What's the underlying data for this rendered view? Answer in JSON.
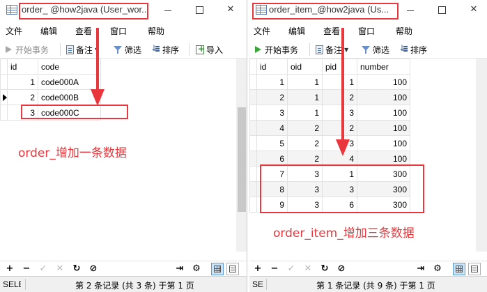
{
  "colors": {
    "annotation": "#e8383d",
    "grid_border": "#e2e2e2",
    "statusbar": "#f0f0f0"
  },
  "menu": [
    "文件",
    "编辑",
    "查看",
    "窗口",
    "帮助"
  ],
  "left": {
    "title": "order_ @how2java (User_wor...",
    "toolbar": {
      "begin_tx": "开始事务",
      "memo": "备注",
      "filter": "筛选",
      "sort": "排序",
      "import": "导入"
    },
    "columns": [
      "id",
      "code"
    ],
    "rows": [
      [
        "1",
        "code000A"
      ],
      [
        "2",
        "code000B"
      ],
      [
        "3",
        "code000C"
      ]
    ],
    "status_sql": "SELE",
    "status_record": "第 2 条记录 (共 3 条) 于第 1 页",
    "annotation": "order_增加一条数据"
  },
  "right": {
    "title": "order_item_@how2java (Us...",
    "toolbar": {
      "begin_tx": "开始事务",
      "memo": "备注",
      "filter": "筛选",
      "sort": "排序"
    },
    "columns": [
      "id",
      "oid",
      "pid",
      "number"
    ],
    "rows": [
      [
        "1",
        "1",
        "1",
        "100"
      ],
      [
        "2",
        "1",
        "2",
        "100"
      ],
      [
        "3",
        "1",
        "3",
        "100"
      ],
      [
        "4",
        "2",
        "2",
        "100"
      ],
      [
        "5",
        "2",
        "3",
        "100"
      ],
      [
        "6",
        "2",
        "4",
        "100"
      ],
      [
        "7",
        "3",
        "1",
        "300"
      ],
      [
        "8",
        "3",
        "3",
        "300"
      ],
      [
        "9",
        "3",
        "6",
        "300"
      ]
    ],
    "status_sql": "SE",
    "status_record": "第 1 条记录 (共 9 条) 于第 1 页",
    "annotation": "order_item_增加三条数据"
  }
}
